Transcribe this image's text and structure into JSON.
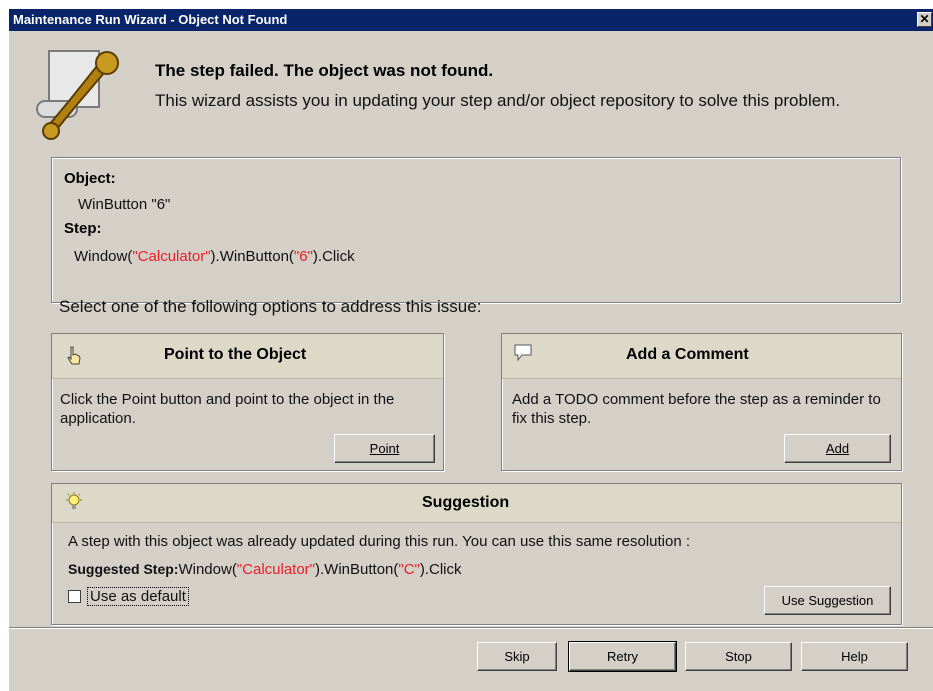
{
  "window": {
    "title": "Maintenance Run Wizard - Object Not Found",
    "close_glyph": "✕"
  },
  "header": {
    "title": "The step failed. The object was not found.",
    "description": "This wizard assists you in updating your step and/or object repository to solve this problem."
  },
  "object_info": {
    "object_label": "Object:",
    "object_value": "WinButton \"6\"",
    "step_label": "Step:",
    "step_prefix": "Window(",
    "step_window": "\"Calculator\"",
    "step_mid": ").WinButton(",
    "step_button": "\"6\"",
    "step_suffix": ").Click"
  },
  "options_prompt": "Select one of the following options to address this issue:",
  "point_card": {
    "title": "Point to the Object",
    "body": "Click the Point button and point to the object in the application.",
    "button": "Point"
  },
  "comment_card": {
    "title": "Add a Comment",
    "body": "Add a TODO comment before the step as a reminder to fix this step.",
    "button": "Add"
  },
  "suggestion_card": {
    "title": "Suggestion",
    "body": "A step with this object was already updated during this run. You can use this same resolution :",
    "suggested_label": "Suggested Step:",
    "step_prefix": "Window(",
    "step_window": "\"Calculator\"",
    "step_mid": ").WinButton(",
    "step_button": "\"C\"",
    "step_suffix": ").Click",
    "checkbox_label": "Use as default",
    "checkbox_checked": false,
    "button": "Use Suggestion"
  },
  "footer": {
    "skip": "Skip",
    "retry": "Retry",
    "stop": "Stop",
    "help": "Help"
  },
  "colors": {
    "titlebar": "#0a246a",
    "highlight": "#e8202a",
    "dialog": "#d4d0c8"
  }
}
